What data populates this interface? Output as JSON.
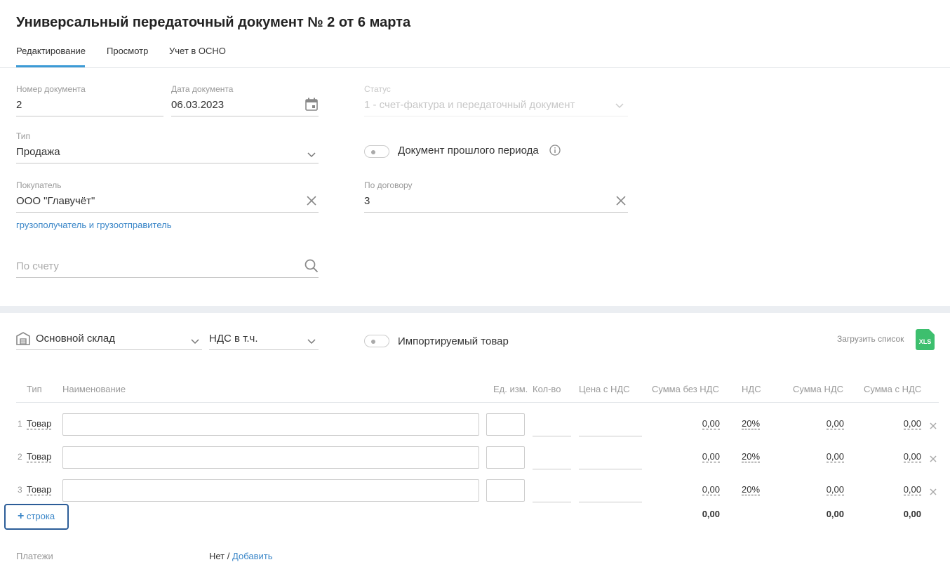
{
  "header": {
    "title": "Универсальный передаточный документ № 2 от 6 марта",
    "tabs": [
      {
        "label": "Редактирование"
      },
      {
        "label": "Просмотр"
      },
      {
        "label": "Учет в ОСНО"
      }
    ]
  },
  "form": {
    "doc_number": {
      "label": "Номер документа",
      "value": "2"
    },
    "doc_date": {
      "label": "Дата документа",
      "value": "06.03.2023"
    },
    "status": {
      "label": "Статус",
      "value": "1 - счет-фактура и передаточный документ"
    },
    "type": {
      "label": "Тип",
      "value": "Продажа"
    },
    "past_period": {
      "label": "Документ прошлого периода"
    },
    "buyer": {
      "label": "Покупатель",
      "value": "ООО \"Главучёт\""
    },
    "contract": {
      "label": "По договору",
      "value": "3"
    },
    "shipper_link": "грузополучатель и грузоотправитель",
    "invoice": {
      "placeholder": "По счету"
    }
  },
  "goods": {
    "warehouse": "Основной склад",
    "vat_mode": "НДС в т.ч.",
    "imported_label": "Импортируемый товар",
    "upload_label": "Загрузить список",
    "xls_label": "XLS",
    "columns": {
      "type": "Тип",
      "name": "Наименование",
      "unit": "Ед. изм.",
      "qty": "Кол-во",
      "price": "Цена с НДС",
      "sum_no_vat": "Сумма без НДС",
      "vat": "НДС",
      "vat_sum": "Сумма НДС",
      "sum_with_vat": "Сумма с НДС"
    },
    "rows": [
      {
        "num": "1",
        "type": "Товар",
        "sum_no_vat": "0,00",
        "vat": "20%",
        "vat_sum": "0,00",
        "sum_with_vat": "0,00"
      },
      {
        "num": "2",
        "type": "Товар",
        "sum_no_vat": "0,00",
        "vat": "20%",
        "vat_sum": "0,00",
        "sum_with_vat": "0,00"
      },
      {
        "num": "3",
        "type": "Товар",
        "sum_no_vat": "0,00",
        "vat": "20%",
        "vat_sum": "0,00",
        "sum_with_vat": "0,00"
      }
    ],
    "add_row_label": "строка",
    "totals": {
      "sum_no_vat": "0,00",
      "vat_sum": "0,00",
      "sum_with_vat": "0,00"
    }
  },
  "payments": {
    "label": "Платежи",
    "value": "Нет",
    "divider": "/",
    "add_label": "Добавить"
  }
}
